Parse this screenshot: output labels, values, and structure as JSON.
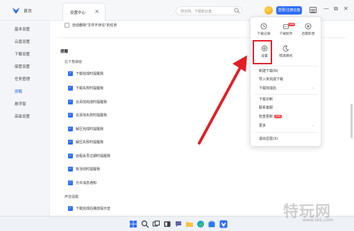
{
  "titlebar": {
    "home_label": "首页",
    "tab_label": "设置中心",
    "tab_close": "×",
    "search_placeholder": "搜全网、下载和云盘",
    "login_label": "登录/注册云盘",
    "minimize": "—",
    "restore": "⧉",
    "close": "✕"
  },
  "sidebar": {
    "items": [
      {
        "label": "基本设置"
      },
      {
        "label": "云盘设置"
      },
      {
        "label": "下载设置"
      },
      {
        "label": "接管设置"
      },
      {
        "label": "任务管理"
      },
      {
        "label": "提醒"
      },
      {
        "label": "悬浮窗"
      },
      {
        "label": "高级设置"
      }
    ],
    "active_index": 5
  },
  "main": {
    "auto_delete_label": "自动删除\"文件不存在\"的任务",
    "reminder_title": "提醒",
    "corner_popup_title": "右下角弹窗",
    "reminders": [
      {
        "label": "下载完成时提醒我",
        "checked": true
      },
      {
        "label": "下载失败时提醒我",
        "checked": true
      },
      {
        "label": "云添加完成时提醒我",
        "checked": true
      },
      {
        "label": "云添加失败时提醒我",
        "checked": true
      },
      {
        "label": "解压完成时提醒我",
        "checked": true
      },
      {
        "label": "解压失败时提醒我",
        "checked": true
      },
      {
        "label": "远程会员过期时提醒我",
        "checked": true
      },
      {
        "label": "有活动时提醒我",
        "checked": true
      },
      {
        "label": "允许消息通知",
        "checked": true
      }
    ],
    "sound_title": "声音提醒",
    "sound_items": [
      {
        "label": "下载完成后播放提示音",
        "checked": true
      }
    ]
  },
  "dropdown": {
    "top_icons": [
      {
        "label": "下载记录",
        "icon": "history-icon"
      },
      {
        "label": "下载助手",
        "icon": "assistant-icon",
        "badge": "new"
      },
      {
        "label": "迅雷影音",
        "icon": "player-icon"
      }
    ],
    "second_icons": [
      {
        "label": "设置",
        "icon": "settings-icon"
      },
      {
        "label": "暗黑模式",
        "icon": "dark-mode-icon"
      }
    ],
    "items": [
      {
        "label": "新建下载(N)"
      },
      {
        "label": "导入未完成下载"
      },
      {
        "label": "下载完成后",
        "arrow": "›"
      },
      {
        "label": "下载诊断"
      },
      {
        "label": "联系客服"
      },
      {
        "label": "检查更新",
        "badge": "new"
      },
      {
        "label": "更多",
        "arrow": "›"
      },
      {
        "label": "退出迅雷(X)"
      }
    ]
  },
  "watermark": {
    "brand": "特玩网",
    "url": "www.te5.com"
  },
  "colors": {
    "accent": "#2f6df6",
    "highlight": "#e21f26",
    "badge": "#f04646"
  }
}
